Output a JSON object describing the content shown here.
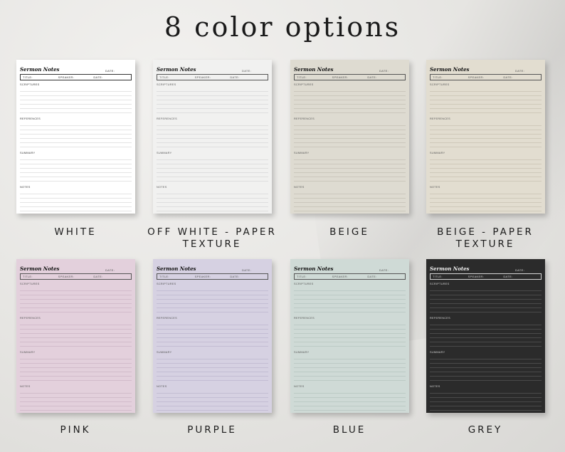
{
  "headline": "8 color options",
  "template": {
    "title": "Sermon Notes",
    "date_label": "DATE:",
    "title_label": "TITLE:",
    "speaker_label": "SPEAKER:",
    "sections": [
      "SCRIPTURES",
      "REFERENCES",
      "SUMMARY",
      "NOTES"
    ]
  },
  "options": [
    {
      "caption": "WHITE",
      "bg": "#ffffff",
      "ink": "#333333",
      "line": "#e4e4e4"
    },
    {
      "caption": "OFF WHITE - PAPER TEXTURE",
      "bg": "#f1f1f0",
      "ink": "#555555",
      "line": "#dedede"
    },
    {
      "caption": "BEIGE",
      "bg": "#dedbd1",
      "ink": "#555555",
      "line": "#cbc7bc"
    },
    {
      "caption": "BEIGE - PAPER TEXTURE",
      "bg": "#e2ddd0",
      "ink": "#555555",
      "line": "#cfc9ba"
    },
    {
      "caption": "PINK",
      "bg": "#e3d0dc",
      "ink": "#555555",
      "line": "#d2bccb"
    },
    {
      "caption": "PURPLE",
      "bg": "#d6d1e2",
      "ink": "#555555",
      "line": "#c3bdd3"
    },
    {
      "caption": "BLUE",
      "bg": "#cfdad6",
      "ink": "#555555",
      "line": "#bccac5"
    },
    {
      "caption": "GREY",
      "bg": "#2b2b2b",
      "ink": "#d6d6d6",
      "line": "#4a4a4a"
    }
  ]
}
